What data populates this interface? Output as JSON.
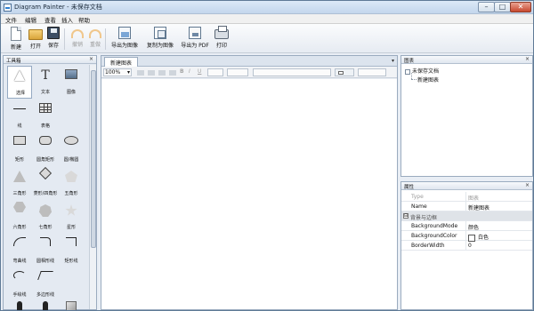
{
  "window": {
    "title": "Diagram Painter - 未保存文档",
    "controls": {
      "minimize": "–",
      "maximize": "□",
      "close": "✕"
    }
  },
  "menu": [
    "文件",
    "编辑",
    "查看",
    "插入",
    "帮助"
  ],
  "toolbar": [
    {
      "label": "新建",
      "icon": "new-file-icon",
      "enabled": true
    },
    {
      "label": "打开",
      "icon": "open-folder-icon",
      "enabled": true
    },
    {
      "label": "保存",
      "icon": "save-icon",
      "enabled": true
    },
    {
      "label": "撤销",
      "icon": "undo-icon",
      "enabled": false
    },
    {
      "label": "重做",
      "icon": "redo-icon",
      "enabled": false
    },
    {
      "label": "导出为图像",
      "icon": "export-image-icon",
      "enabled": true
    },
    {
      "label": "复制为图像",
      "icon": "copy-image-icon",
      "enabled": true
    },
    {
      "label": "导出为 PDF",
      "icon": "export-pdf-icon",
      "enabled": true
    },
    {
      "label": "打印",
      "icon": "print-icon",
      "enabled": true
    }
  ],
  "toolbox": {
    "title": "工具箱",
    "close": "×",
    "tools": [
      {
        "label": "选择",
        "icon": "pointer-icon",
        "selected": true
      },
      {
        "label": "文本",
        "icon": "text-icon"
      },
      {
        "label": "图像",
        "icon": "image-icon"
      },
      {
        "label": "线",
        "icon": "line-icon"
      },
      {
        "label": "表格",
        "icon": "table-icon"
      },
      {
        "label": "",
        "icon": "blank"
      },
      {
        "label": "矩形",
        "icon": "rectangle-icon"
      },
      {
        "label": "圆角矩形",
        "icon": "rounded-rectangle-icon"
      },
      {
        "label": "圆/椭圆",
        "icon": "ellipse-icon"
      },
      {
        "label": "三角形",
        "icon": "triangle-icon"
      },
      {
        "label": "菱形/四角形",
        "icon": "diamond-icon"
      },
      {
        "label": "五角形",
        "icon": "pentagon-icon"
      },
      {
        "label": "六角形",
        "icon": "hexagon-icon"
      },
      {
        "label": "七角形",
        "icon": "heptagon-icon"
      },
      {
        "label": "星形",
        "icon": "star-icon"
      },
      {
        "label": "弯曲线",
        "icon": "curve-icon"
      },
      {
        "label": "圆相形线",
        "icon": "rounded-elbow-icon"
      },
      {
        "label": "矩形线",
        "icon": "elbow-icon"
      },
      {
        "label": "手绘线",
        "icon": "freehand-icon"
      },
      {
        "label": "多边形线",
        "icon": "polyline-icon"
      },
      {
        "label": "",
        "icon": "blank"
      },
      {
        "label": "",
        "icon": "person-icon"
      },
      {
        "label": "",
        "icon": "person-icon"
      },
      {
        "label": "",
        "icon": "cube-icon"
      }
    ]
  },
  "document": {
    "tab": "新建图表",
    "tab_menu": "▾",
    "zoom": "100%",
    "format": {
      "bold": "B",
      "italic": "I",
      "underline": "U"
    }
  },
  "diagram_panel": {
    "title": "图表",
    "close": "×",
    "root": "未保存文档",
    "child": "新建图表"
  },
  "properties": {
    "title": "属性",
    "close": "×",
    "rows": [
      {
        "key": "Type",
        "value": "图表",
        "muted": true
      },
      {
        "key": "Name",
        "value": "新建图表"
      },
      {
        "key": "背景与边框",
        "value": "",
        "group": true,
        "toggle": "⊟"
      },
      {
        "key": "BackgroundMode",
        "value": "颜色"
      },
      {
        "key": "BackgroundColor",
        "value": "白色",
        "swatch": "#ffffff"
      },
      {
        "key": "BorderWidth",
        "value": "0"
      }
    ]
  }
}
